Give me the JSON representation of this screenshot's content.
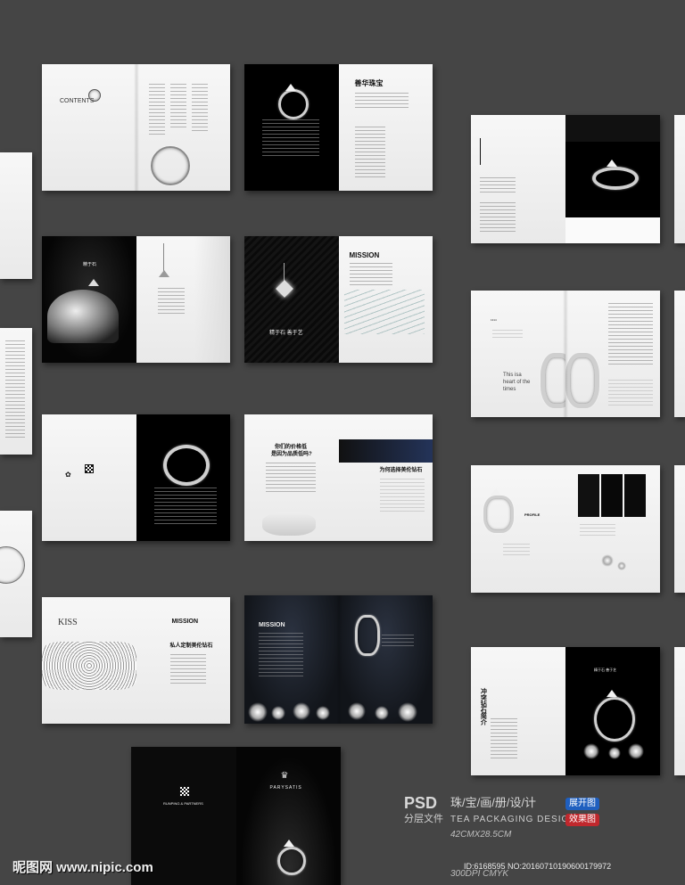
{
  "spreads": {
    "contents": {
      "title": "CONTENTS"
    },
    "mission_dark": {
      "heading": "MISSION",
      "caption": "精于石 善于艺"
    },
    "why_choose": {
      "question_line1": "你们的价格低",
      "question_line2": "是因为品质低吗?",
      "title": "为何选择美伦钻石"
    },
    "kiss": {
      "title": "KISS",
      "mission": "MISSION",
      "headline": "私人定制美伦钻石"
    },
    "mission_navy": {
      "heading": "MISSION"
    },
    "cover": {
      "brand": "PARYSATIS",
      "partners": "RUNPING & PARTNERS"
    },
    "profile": {
      "heading": "PROFILE"
    },
    "heart": {
      "line1": "This isa",
      "line2": "heart of the",
      "line3": "times"
    },
    "intro": {
      "title": "冲突钻石简介"
    }
  },
  "footer": {
    "psd": "PSD",
    "title_cn": "珠/宝/画/册/设/计",
    "layered": "分层文件",
    "title_en": "TEA PACKAGING DESIGN",
    "badge_open": "展开图",
    "badge_effect": "效果图",
    "size": "42CMX28.5CM",
    "dpi": "300DPI CMYK",
    "id_line": "ID:6168595 NO:20160710190600179972",
    "watermark": "昵图网 www.nipic.com"
  },
  "colors": {
    "background": "#454545",
    "badge_blue": "#1f5fbf",
    "badge_red": "#c0282d"
  }
}
